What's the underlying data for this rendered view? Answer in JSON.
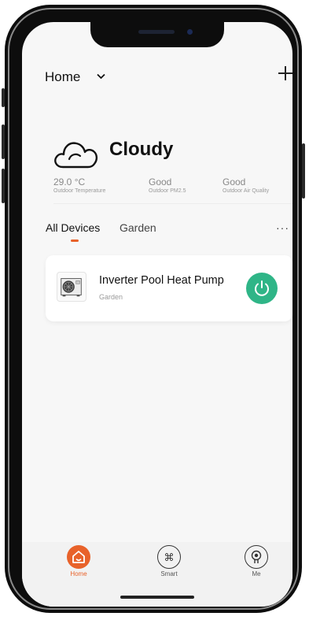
{
  "header": {
    "title": "Home",
    "chevron": "⌄",
    "add_icon": "plus-icon"
  },
  "weather": {
    "condition": "Cloudy",
    "icon": "cloud-icon",
    "stats": [
      {
        "value": "29.0 °C",
        "label": "Outdoor Temperature"
      },
      {
        "value": "Good",
        "label": "Outdoor PM2.5"
      },
      {
        "value": "Good",
        "label": "Outdoor Air Quality"
      }
    ]
  },
  "tabs": [
    {
      "label": "All Devices",
      "active": true
    },
    {
      "label": "Garden",
      "active": false
    }
  ],
  "more_label": "···",
  "devices": [
    {
      "name": "Inverter Pool Heat Pump",
      "room": "Garden",
      "power_on": true,
      "icon": "heat-pump-icon"
    }
  ],
  "tabbar": [
    {
      "label": "Home",
      "icon": "home-icon",
      "active": true
    },
    {
      "label": "Smart",
      "icon": "command-icon",
      "active": false
    },
    {
      "label": "Me",
      "icon": "person-icon",
      "active": false
    }
  ],
  "colors": {
    "accent": "#e8622a",
    "power": "#2fb587"
  }
}
